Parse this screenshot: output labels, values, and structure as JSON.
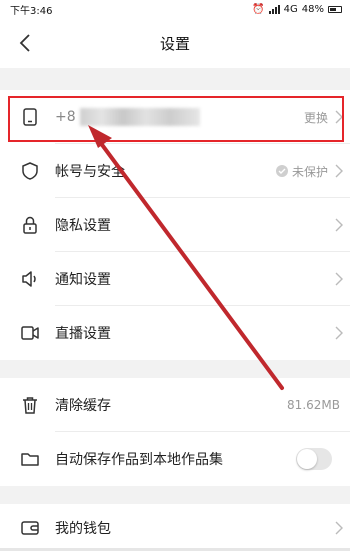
{
  "status_bar": {
    "time": "下午3:46",
    "network": "4G",
    "battery": "48%"
  },
  "header": {
    "title": "设置"
  },
  "account": {
    "phone_prefix": "+8",
    "action": "更换"
  },
  "security": {
    "label": "帐号与安全",
    "status": "未保护"
  },
  "privacy": {
    "label": "隐私设置"
  },
  "notifications": {
    "label": "通知设置"
  },
  "live": {
    "label": "直播设置"
  },
  "cache": {
    "label": "清除缓存",
    "size": "81.62MB"
  },
  "autosave": {
    "label": "自动保存作品到本地作品集",
    "enabled": false
  },
  "wallet": {
    "label": "我的钱包"
  },
  "colors": {
    "highlight": "#e5252a",
    "arrow": "#c0282d",
    "section_bg": "#f2f2f2"
  },
  "icons": [
    "back-icon",
    "phone-icon",
    "shield-icon",
    "lock-icon",
    "speaker-icon",
    "video-icon",
    "trash-icon",
    "folder-icon",
    "wallet-icon",
    "chevron-right-icon",
    "check-icon"
  ]
}
